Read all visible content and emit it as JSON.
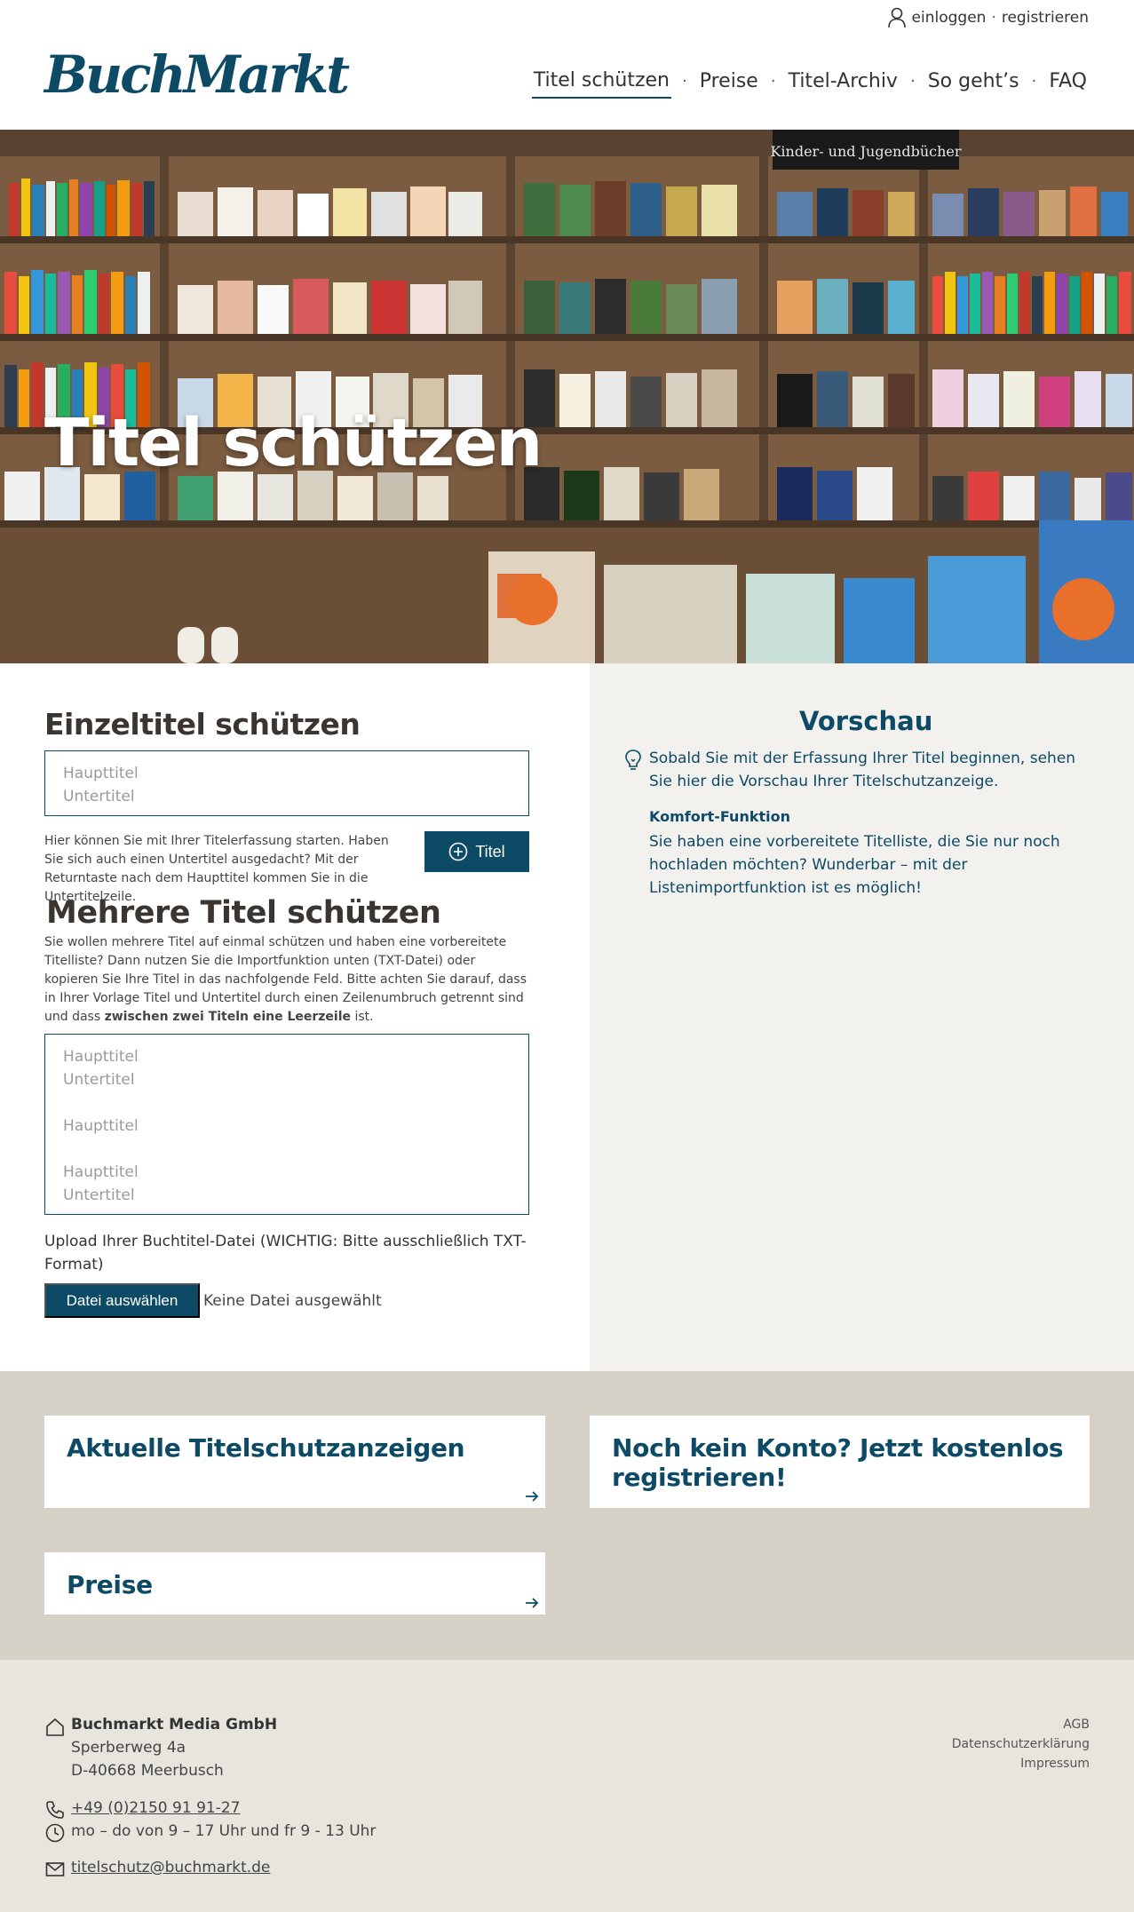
{
  "header": {
    "account": {
      "login": "einloggen",
      "separator": "·",
      "register": "registrieren"
    },
    "logo": "BuchMarkt",
    "nav": [
      {
        "label": "Titel schützen",
        "active": true
      },
      {
        "label": "Preise"
      },
      {
        "label": "Titel-Archiv"
      },
      {
        "label": "So geht’s"
      },
      {
        "label": "FAQ"
      }
    ],
    "nav_separator": "·"
  },
  "hero": {
    "title": "Titel schützen",
    "sign": "Kinder- und Jugendbücher"
  },
  "single": {
    "heading": "Einzeltitel schützen",
    "placeholder_main": "Haupttitel",
    "placeholder_sub": "Untertitel",
    "help": "Hier können Sie mit Ihrer Titelerfassung starten. Haben Sie sich auch einen Untertitel ausgedacht? Mit der Returntaste nach dem Haupttitel kommen Sie in die Untertitelzeile.",
    "button": "Titel"
  },
  "multi": {
    "heading": "Mehrere Titel schützen",
    "help_a": "Sie wollen mehrere Titel auf einmal schützen und haben eine vorbereitete Titelliste? Dann nutzen Sie die Importfunktion unten (TXT-Datei) oder kopieren Sie Ihre Titel in das nachfolgende Feld. Bitte achten Sie darauf, dass in Ihrer Vorlage Titel und Untertitel durch einen Zeilenumbruch getrennt sind und dass ",
    "help_bold": "zwischen zwei Titeln eine Leerzeile",
    "help_b": " ist.",
    "placeholder_lines": [
      "Haupttitel",
      "Untertitel",
      "",
      "Haupttitel",
      "",
      "Haupttitel",
      "Untertitel"
    ],
    "upload_label": "Upload Ihrer Buchtitel-Datei (WICHTIG: Bitte ausschließlich TXT-Format)",
    "file_button": "Datei auswählen",
    "no_file": "Keine Datei ausgewählt"
  },
  "preview": {
    "title": "Vorschau",
    "text": "Sobald Sie mit der Erfassung Ihrer Titel beginnen, sehen Sie hier die Vorschau Ihrer Titelschutzanzeige.",
    "komfort_heading": "Komfort-Funktion",
    "komfort_text": "Sie haben eine vorbereitete Titelliste, die Sie nur noch hochladen möchten? Wunderbar – mit der Listenimportfunktion ist es möglich!"
  },
  "cards": [
    {
      "title": "Aktuelle Titelschutzanzeigen"
    },
    {
      "title": "Noch kein Konto? Jetzt kostenlos registrieren!"
    },
    {
      "title": "Preise"
    }
  ],
  "footer": {
    "company": "Buchmarkt Media GmbH",
    "street": "Sperberweg 4a",
    "city": "D-40668 Meerbusch",
    "phone": "+49 (0)2150 91 91-27",
    "hours": "mo – do von 9 – 17 Uhr und fr 9 - 13 Uhr",
    "email": "titelschutz@buchmarkt.de",
    "links": [
      "AGB",
      "Datenschutzerklärung",
      "Impressum"
    ]
  },
  "colors": {
    "brand": "#0c4a66",
    "preview_bg": "#f3f1ee",
    "cards_bg": "#d6d1c7",
    "footer_bg": "#e8e4de"
  }
}
